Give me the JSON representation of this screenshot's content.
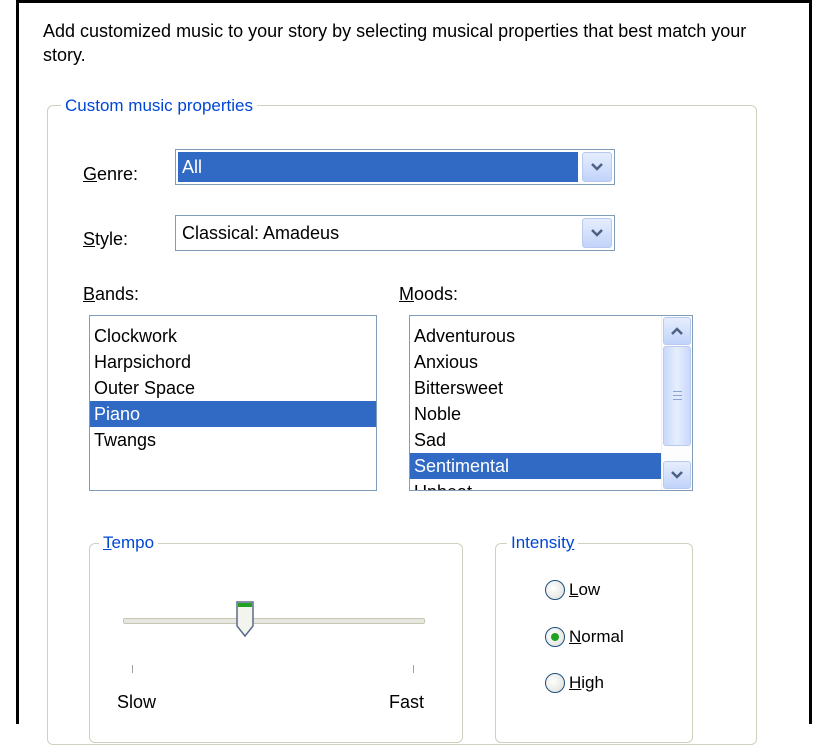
{
  "intro_text": "Add customized music to your story by selecting musical properties that best match your story.",
  "custom_group": {
    "title": "Custom music properties"
  },
  "genre": {
    "label_hot": "G",
    "label_rest": "enre:",
    "value": "All"
  },
  "style": {
    "label_hot": "S",
    "label_rest": "tyle:",
    "value": "Classical: Amadeus"
  },
  "bands": {
    "label_hot": "B",
    "label_rest": "ands:",
    "items": [
      "Clockwork",
      "Harpsichord",
      "Outer Space",
      "Piano",
      "Twangs"
    ],
    "selected": "Piano"
  },
  "moods": {
    "label_hot": "M",
    "label_rest": "oods:",
    "items": [
      "Adventurous",
      "Anxious",
      "Bittersweet",
      "Noble",
      "Sad",
      "Sentimental",
      "Upbeat"
    ],
    "selected": "Sentimental"
  },
  "tempo": {
    "title_hot": "T",
    "title_rest": "empo",
    "min_label": "Slow",
    "max_label": "Fast",
    "level": 0.4
  },
  "intensity": {
    "title_rest": "Intensit",
    "title_hot": "y",
    "options": [
      {
        "hot": "L",
        "rest": "ow",
        "checked": false
      },
      {
        "hot": "N",
        "rest": "ormal",
        "checked": true
      },
      {
        "hot": "H",
        "rest": "igh",
        "checked": false
      }
    ]
  },
  "colors": {
    "accent": "#316ac5",
    "group_title": "#0046d5",
    "radio_dot": "#21a121"
  },
  "icons": {
    "dropdown": "chevron-down-icon",
    "scroll_up": "chevron-up-icon",
    "scroll_down": "chevron-down-icon"
  }
}
